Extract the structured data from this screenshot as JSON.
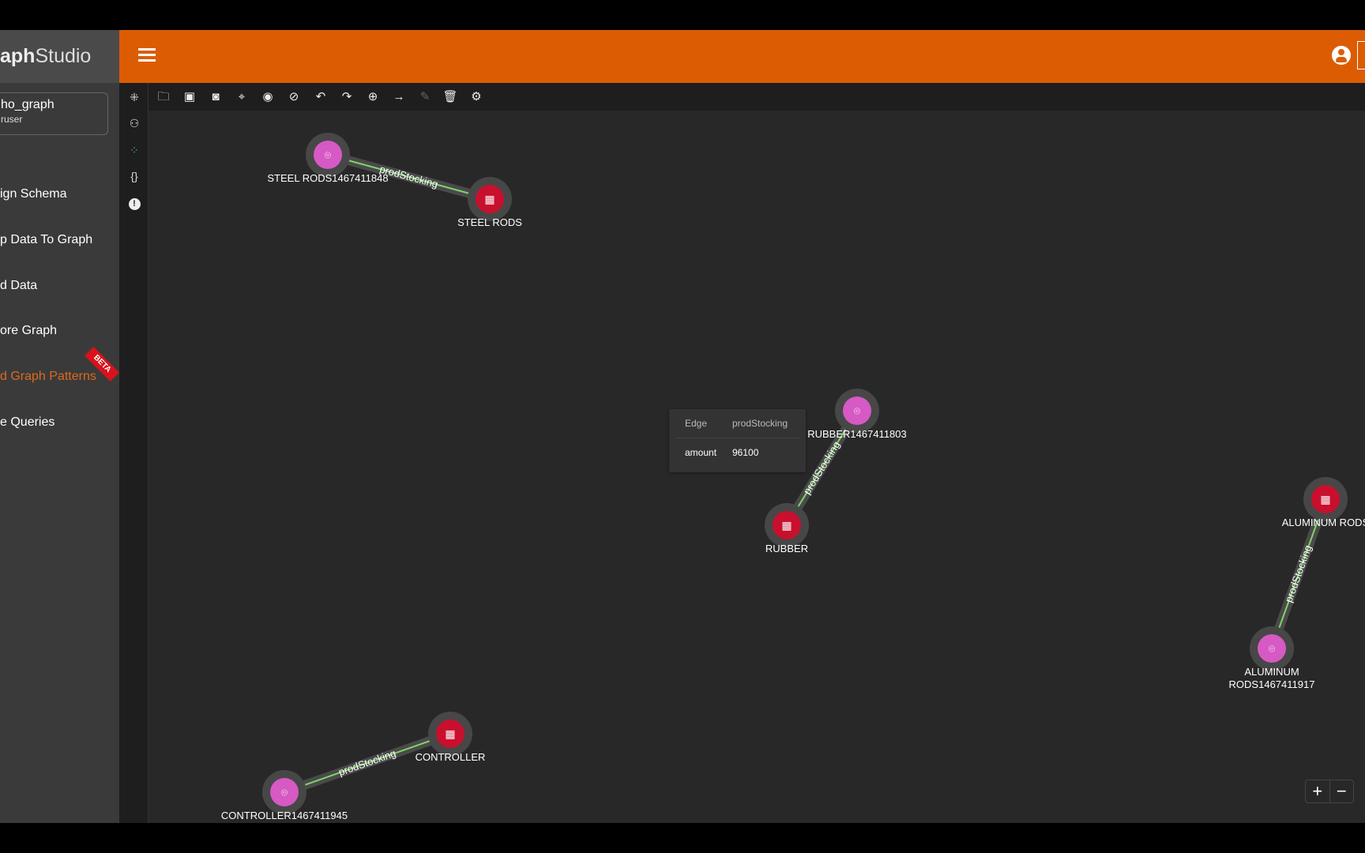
{
  "app": {
    "logo_bold": "aph",
    "logo_light": "Studio",
    "accent": "#dc5c04"
  },
  "sidebar": {
    "project_name": "ho_graph",
    "project_user": "ruser",
    "items": [
      {
        "label": "ign Schema"
      },
      {
        "label": "p Data To Graph"
      },
      {
        "label": "d Data"
      },
      {
        "label": "ore Graph"
      },
      {
        "label": "d Graph Patterns",
        "active": true,
        "badge": "BETA"
      },
      {
        "label": "e Queries"
      }
    ]
  },
  "icon_column": [
    "collapse-icon",
    "schema-icon",
    "graph-dots-icon",
    "json-braces-icon",
    "info-icon"
  ],
  "toolbar": [
    "folder-open-icon",
    "save-icon",
    "camera-icon",
    "locate-icon",
    "show-icon",
    "hide-icon",
    "undo-icon",
    "redo-icon",
    "add-node-icon",
    "add-edge-icon",
    "edit-icon",
    "delete-icon",
    "settings-icon"
  ],
  "graph": {
    "vertex_colors": {
      "pink": "#d659c4",
      "red": "#c8102e"
    },
    "nodes": [
      {
        "id": "n1",
        "label": "STEEL RODS1467411848",
        "type": "pink"
      },
      {
        "id": "n2",
        "label": "STEEL RODS",
        "type": "red"
      },
      {
        "id": "n3",
        "label": "RUBBER1467411803",
        "type": "pink"
      },
      {
        "id": "n4",
        "label": "RUBBER",
        "type": "red"
      },
      {
        "id": "n5",
        "label": "ALUMINUM RODS",
        "type": "red"
      },
      {
        "id": "n6",
        "label": "ALUMINUM\nRODS1467411917",
        "type": "pink"
      },
      {
        "id": "n7",
        "label": "CONTROLLER",
        "type": "red"
      },
      {
        "id": "n8",
        "label": "CONTROLLER1467411945",
        "type": "pink"
      }
    ],
    "edges": [
      {
        "from": "n1",
        "to": "n2",
        "label": "prodStocking"
      },
      {
        "from": "n3",
        "to": "n4",
        "label": "prodStocking"
      },
      {
        "from": "n6",
        "to": "n5",
        "label": "prodStocking"
      },
      {
        "from": "n8",
        "to": "n7",
        "label": "prodStocking"
      }
    ]
  },
  "tooltip": {
    "header_key": "Edge",
    "header_value": "prodStocking",
    "key": "amount",
    "value": "96100"
  },
  "zoom": {
    "in": "+",
    "out": "−"
  }
}
